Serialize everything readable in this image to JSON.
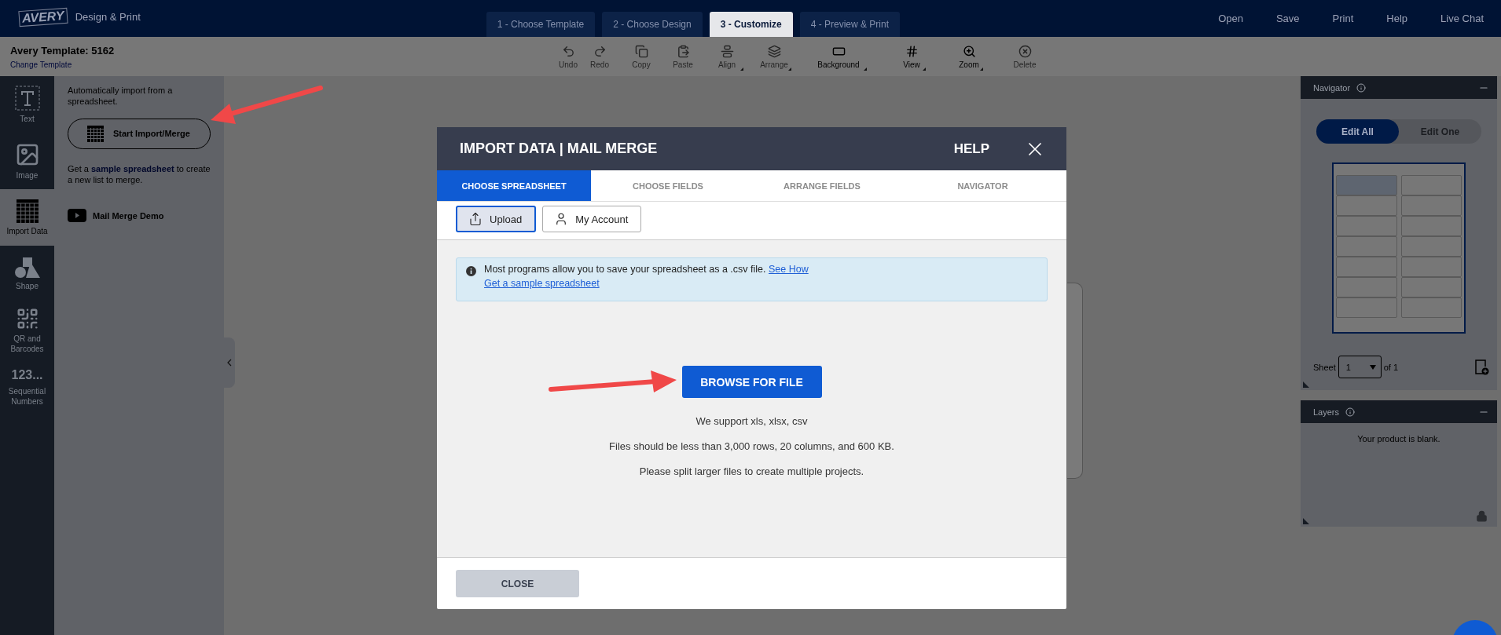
{
  "header": {
    "logo": "AVERY",
    "app_name": "Design & Print",
    "steps": [
      {
        "label": "1 - Choose Template",
        "selected": false
      },
      {
        "label": "2 - Choose Design",
        "selected": false
      },
      {
        "label": "3 - Customize",
        "selected": true
      },
      {
        "label": "4 - Preview & Print",
        "selected": false
      }
    ],
    "menu": [
      "Open",
      "Save",
      "Print",
      "Help",
      "Live Chat"
    ]
  },
  "template_bar": {
    "title": "Avery Template: 5162",
    "link": "Change Template",
    "tools": [
      {
        "kind": "undo",
        "label": "Undo",
        "disabled": true,
        "dropdown": false
      },
      {
        "kind": "redo",
        "label": "Redo",
        "disabled": true,
        "dropdown": false
      },
      {
        "kind": "copy",
        "label": "Copy",
        "disabled": true,
        "dropdown": false
      },
      {
        "kind": "paste",
        "label": "Paste",
        "disabled": true,
        "dropdown": false
      },
      {
        "kind": "align",
        "label": "Align",
        "disabled": true,
        "dropdown": true
      },
      {
        "kind": "arrange",
        "label": "Arrange",
        "disabled": true,
        "dropdown": true
      },
      {
        "kind": "background",
        "label": "Background",
        "disabled": false,
        "dropdown": true
      },
      {
        "kind": "view",
        "label": "View",
        "disabled": false,
        "dropdown": true
      },
      {
        "kind": "zoom",
        "label": "Zoom",
        "disabled": false,
        "dropdown": true
      },
      {
        "kind": "delete",
        "label": "Delete",
        "disabled": true,
        "dropdown": false
      }
    ]
  },
  "sidebar": {
    "items": [
      {
        "kind": "text",
        "label": "Text",
        "selected": false
      },
      {
        "kind": "image",
        "label": "Image",
        "selected": false
      },
      {
        "kind": "import",
        "label": "Import Data",
        "selected": true
      },
      {
        "kind": "shape",
        "label": "Shape",
        "selected": false
      },
      {
        "kind": "qr",
        "label": "QR and Barcodes",
        "selected": false
      },
      {
        "kind": "sequence",
        "label": "Sequential Numbers",
        "glyph": "123...",
        "selected": false
      }
    ]
  },
  "import_panel": {
    "intro": "Automatically import from a spreadsheet.",
    "button": "Start Import/Merge",
    "sample_before": "Get a",
    "sample_link": "sample spreadsheet",
    "sample_after": "to create a new list to merge.",
    "demo": "Mail Merge Demo"
  },
  "navigator": {
    "title": "Navigator",
    "modes": [
      {
        "label": "Edit All",
        "selected": true
      },
      {
        "label": "Edit One",
        "selected": false
      }
    ],
    "sheet_label": "Sheet",
    "sheet_value": "1",
    "sheet_of": "of 1"
  },
  "layers": {
    "title": "Layers",
    "empty": "Your product is blank."
  },
  "modal": {
    "title": "IMPORT DATA | MAIL MERGE",
    "help": "HELP",
    "tabs": [
      {
        "label": "CHOOSE SPREADSHEET",
        "selected": true
      },
      {
        "label": "CHOOSE FIELDS",
        "selected": false
      },
      {
        "label": "ARRANGE FIELDS",
        "selected": false
      },
      {
        "label": "NAVIGATOR",
        "selected": false
      }
    ],
    "sources": [
      {
        "kind": "upload",
        "label": "Upload",
        "selected": true
      },
      {
        "kind": "account",
        "label": "My Account",
        "selected": false
      }
    ],
    "info": {
      "text": "Most programs allow you to save your spreadsheet as a .csv file.",
      "link": "See How",
      "link2": "Get a sample spreadsheet"
    },
    "browse_button": "BROWSE FOR FILE",
    "notes": [
      "We support xls, xlsx, csv",
      "Files should be less than 3,000 rows, 20 columns, and 600 KB.",
      "Please split larger files to create multiple projects."
    ],
    "close_button": "CLOSE"
  }
}
